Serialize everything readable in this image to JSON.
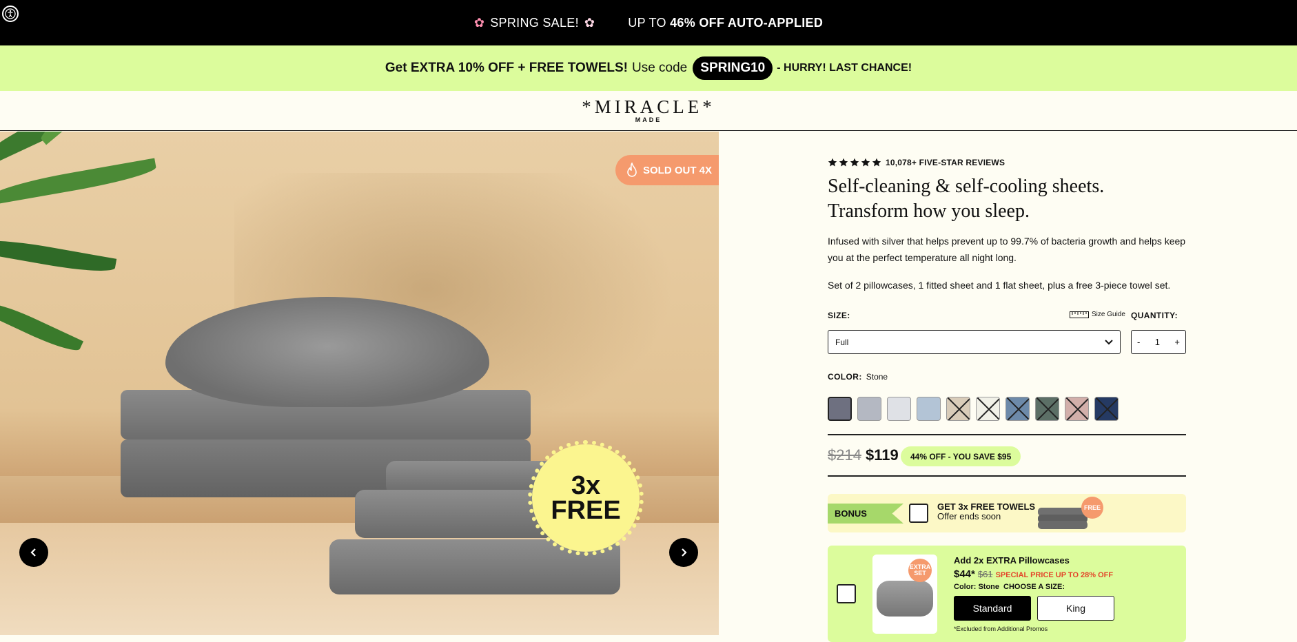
{
  "topbar": {
    "sale_label": "SPRING SALE!",
    "offer_prefix": "UP TO",
    "offer_bold": "46% OFF AUTO-APPLIED"
  },
  "promo": {
    "bold_text": "Get EXTRA 10% OFF + FREE TOWELS!",
    "use_code": "Use code",
    "code": "SPRING10",
    "hurry": "- HURRY! LAST CHANCE!"
  },
  "header": {
    "logo": "*MIRACLE*",
    "logo_sub": "MADE"
  },
  "gallery": {
    "sold_badge": "SOLD OUT 4X",
    "free_badge_line1": "3x",
    "free_badge_line2": "FREE"
  },
  "product": {
    "reviews": "10,078+ FIVE-STAR REVIEWS",
    "rating_stars": 5,
    "title_line1": "Self-cleaning & self-cooling sheets.",
    "title_line2": "Transform how you sleep.",
    "description": "Infused with silver that helps prevent up to 99.7% of bacteria growth and helps keep you at the perfect temperature all night long.",
    "set_text": "Set of 2 pillowcases, 1 fitted sheet and 1 flat sheet, plus a free 3-piece towel set.",
    "size_label": "SIZE:",
    "size_guide": "Size Guide",
    "quantity_label": "QUANTITY:",
    "size_selected": "Full",
    "qty_minus": "-",
    "qty_value": "1",
    "qty_plus": "+",
    "color_label": "COLOR:",
    "color_selected": "Stone",
    "swatches": [
      {
        "color": "#6e7080",
        "selected": true,
        "unavailable": false
      },
      {
        "color": "#b4b8c2",
        "selected": false,
        "unavailable": false
      },
      {
        "color": "#dfe1e6",
        "selected": false,
        "unavailable": false
      },
      {
        "color": "#b3c4d6",
        "selected": false,
        "unavailable": false
      },
      {
        "color": "#d9ccb9",
        "selected": false,
        "unavailable": true
      },
      {
        "color": "#f1f1e8",
        "selected": false,
        "unavailable": true
      },
      {
        "color": "#6d8aa9",
        "selected": false,
        "unavailable": true
      },
      {
        "color": "#5c6f66",
        "selected": false,
        "unavailable": true
      },
      {
        "color": "#d2afaa",
        "selected": false,
        "unavailable": true
      },
      {
        "color": "#253a63",
        "selected": false,
        "unavailable": true
      }
    ],
    "price_old": "$214",
    "price_new": "$119",
    "save_text": "44% OFF - YOU SAVE $95"
  },
  "bonus": {
    "tag": "BONUS",
    "title": "GET 3x FREE TOWELS",
    "subtitle": "Offer ends soon",
    "free_tag": "FREE"
  },
  "upsell": {
    "title": "Add 2x EXTRA Pillowcases",
    "price": "$44*",
    "old_price": "$61",
    "special": "SPECIAL PRICE UP TO 28% OFF",
    "color_text": "Color: Stone",
    "choose_size": "CHOOSE A SIZE:",
    "size_standard": "Standard",
    "size_king": "King",
    "note": "*Excluded from Additional Promos",
    "extra_tag_line1": "EXTRA",
    "extra_tag_line2": "SET"
  },
  "colors": {
    "topbar_bg": "#000000",
    "promo_bg": "#dcfc9c",
    "page_bg": "#fefdf3",
    "accent_orange": "#f59a6d",
    "badge_yellow": "#fbf58f",
    "special_red": "#e3462a"
  }
}
